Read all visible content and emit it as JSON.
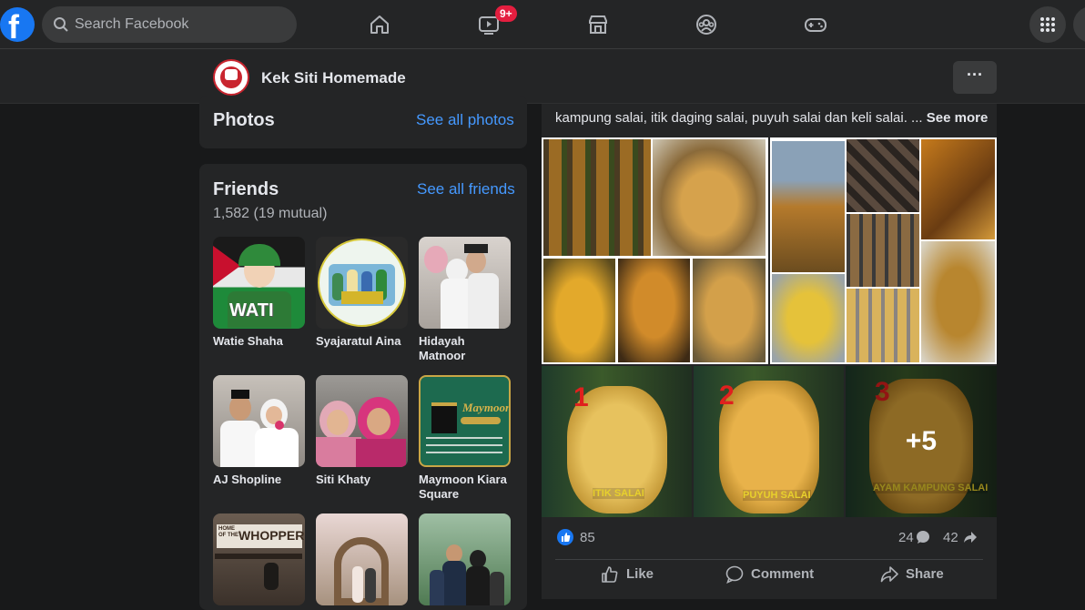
{
  "topnav": {
    "search_placeholder": "Search Facebook",
    "video_badge": "9+"
  },
  "page_header": {
    "name": "Kek Siti Homemade",
    "more_label": "···"
  },
  "photos_card": {
    "title": "Photos",
    "link": "See all photos"
  },
  "friends_card": {
    "title": "Friends",
    "link": "See all friends",
    "count": "1,582 (19 mutual)",
    "friends": [
      {
        "name": "Watie Shaha"
      },
      {
        "name": "Syajaratul Aina"
      },
      {
        "name": "Hidayah Matnoor"
      },
      {
        "name": "AJ Shopline"
      },
      {
        "name": "Siti Khaty"
      },
      {
        "name": "Maymoon Kiara Square"
      }
    ],
    "photo_texts": {
      "wati": "WATI",
      "whopper_home": "HOME OF THE",
      "whopper": "WHOPPER",
      "maymoon": "Maymoon"
    }
  },
  "post": {
    "text_line1": "kampung salai, itik daging salai, puyuh salai dan keli salai. ...",
    "see_more": "See more",
    "image_labels": {
      "n1": "1",
      "n2": "2",
      "n3": "3",
      "p1": "ITIK SALAI",
      "p2": "PUYUH SALAI",
      "p3": "AYAM KAMPUNG SALAI"
    },
    "more_photos": "+5",
    "reactions": "85",
    "comments": "24",
    "shares": "42",
    "like_label": "Like",
    "comment_label": "Comment",
    "share_label": "Share"
  },
  "colors": {
    "accent": "#1877f2",
    "link": "#4599ff",
    "bg": "#18191a",
    "card": "#242526"
  }
}
